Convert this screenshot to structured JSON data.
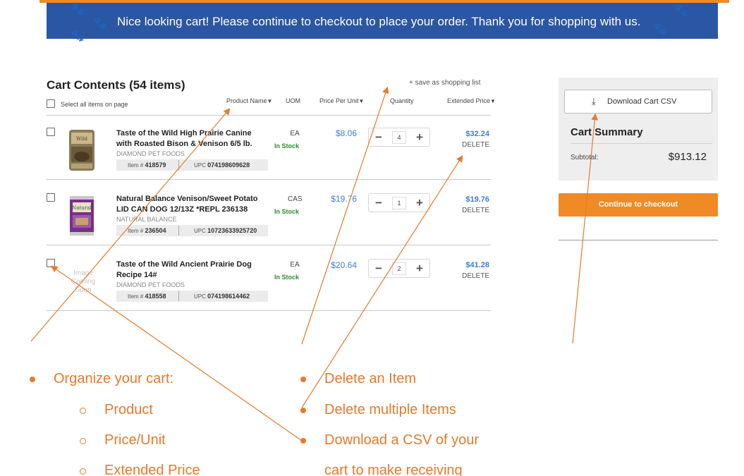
{
  "banner": {
    "message": "Nice looking cart! Please continue to checkout to place your order. Thank you for shopping with us.",
    "color": "#2b56a3"
  },
  "cart": {
    "title": "Cart Contents (54 items)",
    "save_link": "+ save as shopping list",
    "select_all_label": "Select all items on page",
    "columns": {
      "product_name": "Product Name",
      "uom": "UOM",
      "price_per_unit": "Price Per Unit",
      "quantity": "Quantity",
      "extended_price": "Extended Price"
    },
    "items": [
      {
        "name_line1": "Taste of the Wild High Prairie Canine",
        "name_line2": "with Roasted Bison & Venison 6/5 lb.",
        "brand": "DIAMOND PET FOODS",
        "item_label": "Item #",
        "item_no": "418579",
        "upc_label": "UPC",
        "upc": "074198609628",
        "uom": "EA",
        "stock": "In Stock",
        "price": "$8.06",
        "qty": "4",
        "extended": "$32.24",
        "delete": "DELETE"
      },
      {
        "name_line1": "Natural Balance Venison/Sweet Potato",
        "name_line2": "LID CAN DOG 12/13Z *REPL 236138",
        "brand": "NATURAL BALANCE",
        "item_label": "Item #",
        "item_no": "236504",
        "upc_label": "UPC",
        "upc": "10723633925720",
        "uom": "CAS",
        "stock": "In Stock",
        "price": "$19.76",
        "qty": "1",
        "extended": "$19.76",
        "delete": "DELETE"
      },
      {
        "name_line1": "Taste of the Wild Ancient Prairie Dog",
        "name_line2": "Recipe 14#",
        "brand": "DIAMOND PET FOODS",
        "item_label": "Item #",
        "item_no": "418558",
        "upc_label": "UPC",
        "upc": "074198614462",
        "uom": "EA",
        "stock": "In Stock",
        "price": "$20.64",
        "qty": "2",
        "extended": "$41.28",
        "delete": "DELETE",
        "image_placeholder": [
          "Image",
          "Coming",
          "Soon"
        ]
      }
    ]
  },
  "summary": {
    "download_label": "Download Cart CSV",
    "title": "Cart Summary",
    "subtotal_label": "Subtotal:",
    "subtotal_value": "$913.12",
    "checkout_label": "Continue to checkout"
  },
  "notes": {
    "left_heading": "Organize your cart:",
    "left_items": [
      "Product",
      "Price/Unit",
      "Extended Price"
    ],
    "right_items": [
      "Delete an Item",
      "Delete multiple Items",
      "Download a CSV of your",
      "cart to make receiving"
    ]
  },
  "colors": {
    "accent_orange": "#f08a24",
    "annotation_orange": "#e8792b",
    "price_blue": "#3b7dd8",
    "in_stock_green": "#2e8b2e"
  }
}
